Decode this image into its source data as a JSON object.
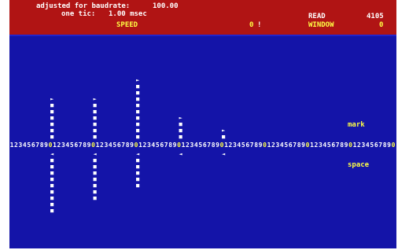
{
  "header": {
    "baud_label": "adjusted for baudrate:",
    "baud_value": "100.00",
    "tic_label": "one tic:",
    "tic_value": "1.00 msec",
    "speed_label": "SPEED",
    "speed_value": "0",
    "speed_marker": "!",
    "read_label": "READ",
    "read_value": "4105",
    "window_label": "WINDOW",
    "window_value": "0"
  },
  "graph": {
    "mark_label": "mark",
    "space_label": "space",
    "timeline_digits": "123456789012345678901234567890123456789012345678901234567890123456789012345678901234567890",
    "mark_glyph": "■",
    "space_glyph": "◄",
    "peak_mark_glyph": "►",
    "bars": [
      {
        "tic": 10,
        "mark": 7,
        "space": 10
      },
      {
        "tic": 20,
        "mark": 7,
        "space": 8
      },
      {
        "tic": 30,
        "mark": 10,
        "space": 6
      },
      {
        "tic": 40,
        "mark": 4,
        "space": 1
      },
      {
        "tic": 50,
        "mark": 2,
        "space": 1
      }
    ]
  }
}
